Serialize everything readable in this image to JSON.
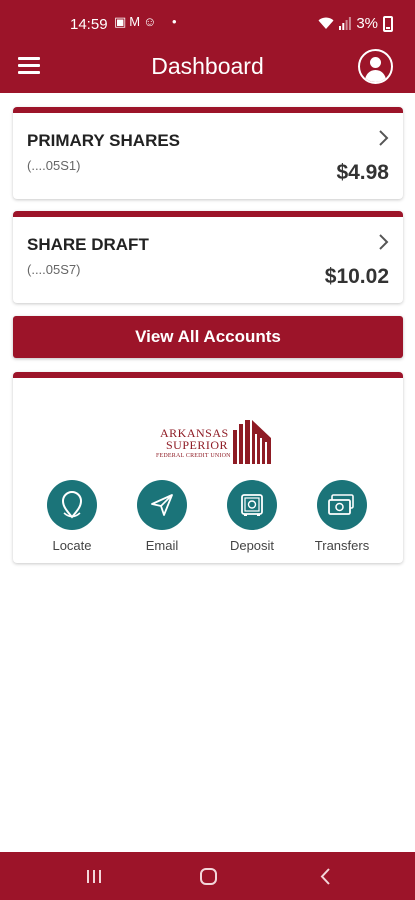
{
  "status_bar": {
    "time": "14:59",
    "notification_icons": [
      "image-icon",
      "gmail-icon",
      "chat-icon",
      "dot-icon"
    ],
    "battery": "3%"
  },
  "app_bar": {
    "title": "Dashboard"
  },
  "accounts": [
    {
      "name": "PRIMARY SHARES",
      "number": "(....05S1)",
      "balance": "$4.98"
    },
    {
      "name": "SHARE DRAFT",
      "number": "(....05S7)",
      "balance": "$10.02"
    }
  ],
  "view_all_label": "View All Accounts",
  "logo": {
    "line1": "ARKANSAS",
    "line2": "SUPERIOR",
    "line3": "FEDERAL CREDIT UNION"
  },
  "quick_actions": [
    {
      "label": "Locate",
      "icon": "location-pin-icon"
    },
    {
      "label": "Email",
      "icon": "paper-plane-icon"
    },
    {
      "label": "Deposit",
      "icon": "safe-icon"
    },
    {
      "label": "Transfers",
      "icon": "money-icon"
    }
  ],
  "colors": {
    "brand": "#9c1429",
    "action_teal": "#1b7479"
  },
  "nav_icons": [
    "recent-apps-icon",
    "home-icon",
    "back-icon"
  ]
}
